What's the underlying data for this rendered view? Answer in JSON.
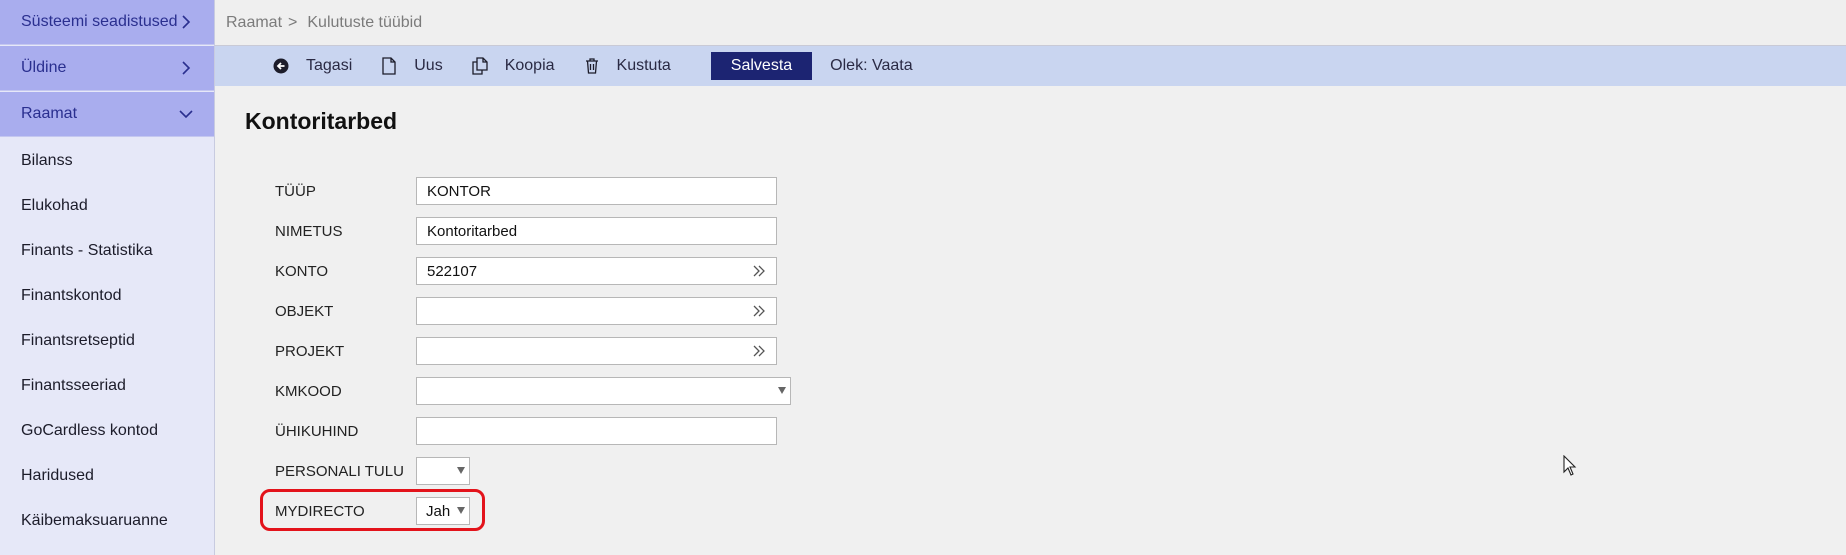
{
  "sidebar": {
    "sections": [
      {
        "label": "Süsteemi seadistused",
        "icon": "chevron-right-icon"
      },
      {
        "label": "Üldine",
        "icon": "chevron-right-icon"
      },
      {
        "label": "Raamat",
        "icon": "chevron-down-icon"
      }
    ],
    "items": [
      {
        "label": "Bilanss"
      },
      {
        "label": "Elukohad"
      },
      {
        "label": "Finants - Statistika"
      },
      {
        "label": "Finantskontod"
      },
      {
        "label": "Finantsretseptid"
      },
      {
        "label": "Finantsseeriad"
      },
      {
        "label": "GoCardless kontod"
      },
      {
        "label": "Haridused"
      },
      {
        "label": "Käibemaksuaruanne"
      }
    ]
  },
  "breadcrumb": {
    "parent": "Raamat",
    "separator": ">",
    "current": "Kulutuste tüübid"
  },
  "toolbar": {
    "back_label": "Tagasi",
    "new_label": "Uus",
    "copy_label": "Koopia",
    "delete_label": "Kustuta",
    "save_label": "Salvesta",
    "status_label": "Olek: Vaata"
  },
  "page": {
    "title": "Kontoritarbed"
  },
  "form": {
    "tyyp": {
      "label": "TÜÜP",
      "value": "KONTOR"
    },
    "nimetus": {
      "label": "NIMETUS",
      "value": "Kontoritarbed"
    },
    "konto": {
      "label": "KONTO",
      "value": "522107"
    },
    "objekt": {
      "label": "OBJEKT",
      "value": ""
    },
    "projekt": {
      "label": "PROJEKT",
      "value": ""
    },
    "kmkood": {
      "label": "KMKOOD",
      "value": ""
    },
    "yhikuhind": {
      "label": "ÜHIKUHIND",
      "value": ""
    },
    "personali_tulu": {
      "label": "PERSONALI TULU",
      "value": ""
    },
    "mydirecto": {
      "label": "MYDIRECTO",
      "value": "Jah"
    }
  },
  "colors": {
    "sidebar_section_bg": "#a9adee",
    "sidebar_bg": "#e6e8f8",
    "toolbar_bg": "#c9d5f0",
    "save_button_bg": "#1c2472",
    "highlight_border": "#e3131b"
  }
}
